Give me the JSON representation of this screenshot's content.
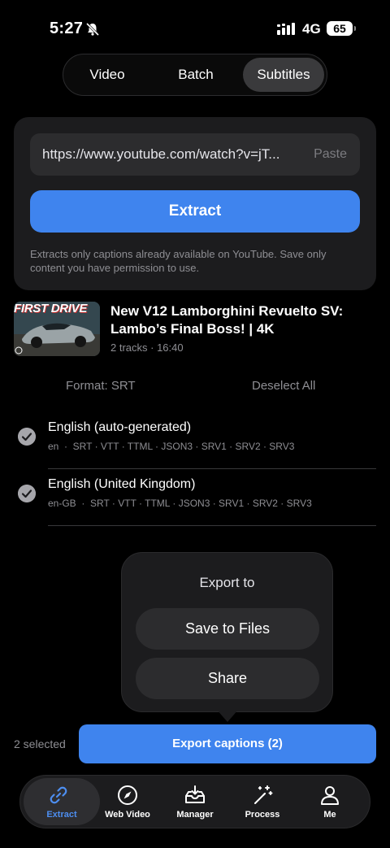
{
  "status_bar": {
    "time": "5:27",
    "network": "4G",
    "battery": "65"
  },
  "segments": [
    {
      "label": "Video",
      "selected": false
    },
    {
      "label": "Batch",
      "selected": false
    },
    {
      "label": "Subtitles",
      "selected": true
    }
  ],
  "extract_card": {
    "url_value": "https://www.youtube.com/watch?v=jT...",
    "paste_label": "Paste",
    "extract_label": "Extract",
    "disclaimer": "Extracts only captions already available on YouTube. Save only content you have permission to use."
  },
  "video": {
    "thumbnail_text": "FIRST DRIVE",
    "title": "New V12 Lamborghini Revuelto SV: Lambo’s Final Boss! | 4K",
    "meta": "2 tracks · 16:40"
  },
  "controls": {
    "format_label": "Format: SRT",
    "deselect_label": "Deselect All"
  },
  "tracks": [
    {
      "name": "English (auto-generated)",
      "formats": "en  ·  SRT · VTT · TTML · JSON3 · SRV1 · SRV2 · SRV3",
      "checked": true
    },
    {
      "name": "English (United Kingdom)",
      "formats": "en-GB  ·  SRT · VTT · TTML · JSON3 · SRV1 · SRV2 · SRV3",
      "checked": true
    }
  ],
  "export_popover": {
    "title": "Export to",
    "save_label": "Save to Files",
    "share_label": "Share"
  },
  "footer": {
    "selected_text": "2 selected",
    "export_label": "Export captions (2)"
  },
  "tabs": [
    {
      "label": "Extract",
      "icon": "link-icon",
      "active": true
    },
    {
      "label": "Web Video",
      "icon": "compass-icon",
      "active": false
    },
    {
      "label": "Manager",
      "icon": "tray-download-icon",
      "active": false
    },
    {
      "label": "Process",
      "icon": "magic-wand-icon",
      "active": false
    },
    {
      "label": "Me",
      "icon": "person-icon",
      "active": false
    }
  ],
  "colors": {
    "accent": "#3f84ee",
    "background": "#000000",
    "card": "#1c1c1e"
  }
}
